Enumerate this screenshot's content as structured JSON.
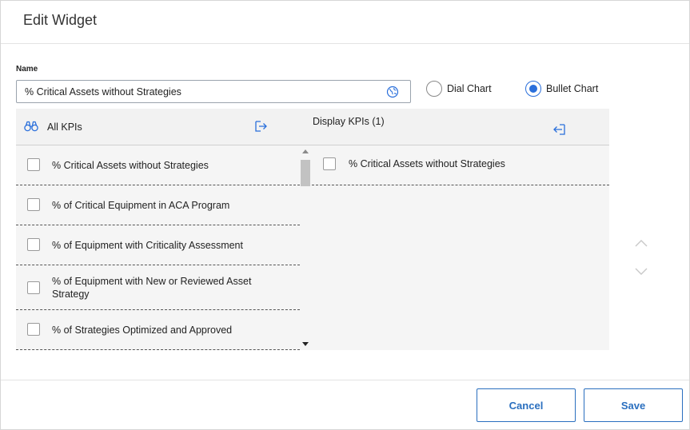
{
  "dialog": {
    "title": "Edit Widget"
  },
  "name_field": {
    "label": "Name",
    "value": "% Critical Assets without Strategies",
    "icon": "globe-icon"
  },
  "chart_type": {
    "options": [
      {
        "label": "Dial Chart",
        "selected": false
      },
      {
        "label": "Bullet Chart",
        "selected": true
      }
    ]
  },
  "all_kpis": {
    "title": "All KPIs",
    "items": [
      "% Critical Assets without Strategies",
      "% of Critical Equipment in ACA Program",
      "% of Equipment with Criticality Assessment",
      "% of Equipment with New or Reviewed Asset Strategy",
      "% of Strategies Optimized and Approved"
    ]
  },
  "display_kpis": {
    "title": "Display KPIs (1)",
    "items": [
      "% Critical Assets without Strategies"
    ]
  },
  "buttons": {
    "cancel": "Cancel",
    "save": "Save"
  },
  "colors": {
    "accent": "#2a6fdb",
    "button_border": "#2a6fbf",
    "panel_bg": "#f5f5f5"
  }
}
